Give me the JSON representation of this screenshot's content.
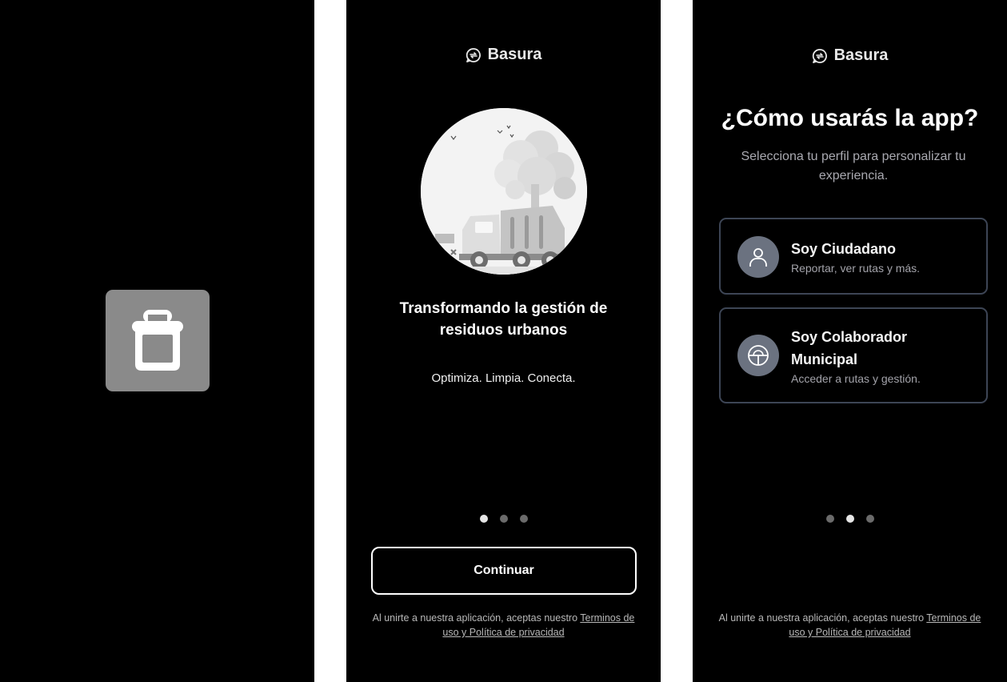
{
  "splash": {
    "icon": "trash-icon",
    "tile_color": "#8a8a8a"
  },
  "onboarding": {
    "brand_name": "Basura",
    "brand_icon": "recycle-chat-icon",
    "illustration": "garbage-truck-illustration",
    "headline": "Transformando la gestión de residuos urbanos",
    "tagline": "Optimiza. Limpia. Conecta.",
    "pagination": {
      "total": 3,
      "active": 1
    },
    "continue_label": "Continuar",
    "legal_prefix": "Al unirte a nuestra aplicación, aceptas nuestro ",
    "legal_link": "Terminos de uso y Política de privacidad"
  },
  "profile": {
    "brand_name": "Basura",
    "title": "¿Cómo usarás la app?",
    "subtitle": "Selecciona tu perfil para personalizar tu experiencia.",
    "options": [
      {
        "title": "Soy Ciudadano",
        "description": "Reportar, ver rutas y más.",
        "icon": "user-icon"
      },
      {
        "title": "Soy Colaborador Municipal",
        "description": "Acceder a rutas y gestión.",
        "icon": "municipal-badge-icon"
      }
    ],
    "pagination": {
      "total": 3,
      "active": 2
    },
    "legal_prefix": "Al unirte a nuestra aplicación, aceptas nuestro ",
    "legal_link": "Terminos de uso y Política de privacidad"
  },
  "colors": {
    "background": "#000000",
    "card_border": "#3d4555",
    "avatar": "#6b7280",
    "dot_inactive": "#6b6b6b",
    "dot_active": "#e6e6e6"
  }
}
